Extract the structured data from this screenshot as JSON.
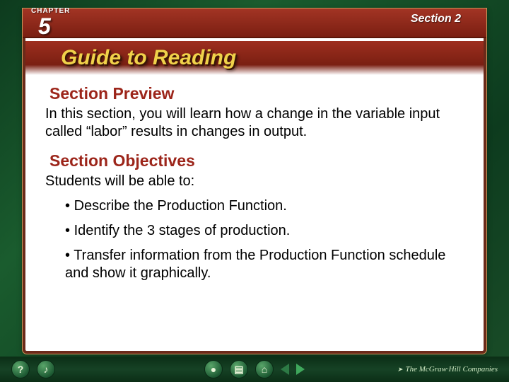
{
  "header": {
    "chapter_label": "CHAPTER",
    "chapter_number": "5",
    "section_label": "Section 2"
  },
  "title": "Guide to Reading",
  "preview": {
    "heading": "Section Preview",
    "text": "In this section, you will learn how a change in the variable input called “labor” results in changes in output."
  },
  "objectives": {
    "heading": "Section Objectives",
    "intro": "Students will be able to:",
    "items": [
      "Describe the Production Function.",
      "Identify the 3 stages of production.",
      "Transfer information from the Production Function schedule and show it graphically."
    ]
  },
  "nav": {
    "help": "?",
    "sound": "♪",
    "globe": "●",
    "book": "▤",
    "home": "⌂",
    "publisher": "The McGraw·Hill Companies"
  }
}
